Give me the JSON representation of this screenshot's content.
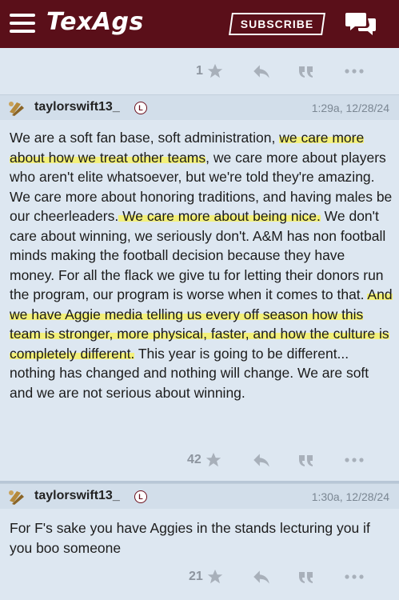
{
  "header": {
    "logo_text": "TexAgs",
    "subscribe_label": "SUBSCRIBE",
    "brand_color": "#5a0f19"
  },
  "posts": [
    {
      "vote_count": "1"
    },
    {
      "username": "taylorswift13_",
      "badge": "L",
      "timestamp": "1:29a, 12/28/24",
      "body_segments": [
        {
          "text": "We are a soft fan base, soft administration, ",
          "highlight": false
        },
        {
          "text": "we care more about how we treat other teams",
          "highlight": true
        },
        {
          "text": ", we care more about players who aren't elite whatsoever, but we're told they're amazing. We care more about honoring traditions, and having males be our cheerleaders.",
          "highlight": false
        },
        {
          "text": " We care more about being nice.",
          "highlight": true
        },
        {
          "text": " We don't care about winning, we seriously don't. A&M has non football minds making the football decision because they have money. For all the flack we give tu for letting their donors run the program, our program is worse when it comes to that. ",
          "highlight": false
        },
        {
          "text": "And we have Aggie media telling us every off season how this team is stronger, more physical, faster, and how the culture is completely different.",
          "highlight": true
        },
        {
          "text": " This year is going to be different... nothing has changed and nothing will change. We are soft and we are not serious about winning.",
          "highlight": false
        }
      ],
      "vote_count": "42"
    },
    {
      "username": "taylorswift13_",
      "badge": "L",
      "timestamp": "1:30a, 12/28/24",
      "body": "For F's sake you have Aggies in the stands lecturing you if you boo someone",
      "vote_count": "21"
    }
  ],
  "icons": {
    "star": "star-icon",
    "reply": "reply-icon",
    "quote": "quote-icon",
    "more": "more-icon"
  }
}
